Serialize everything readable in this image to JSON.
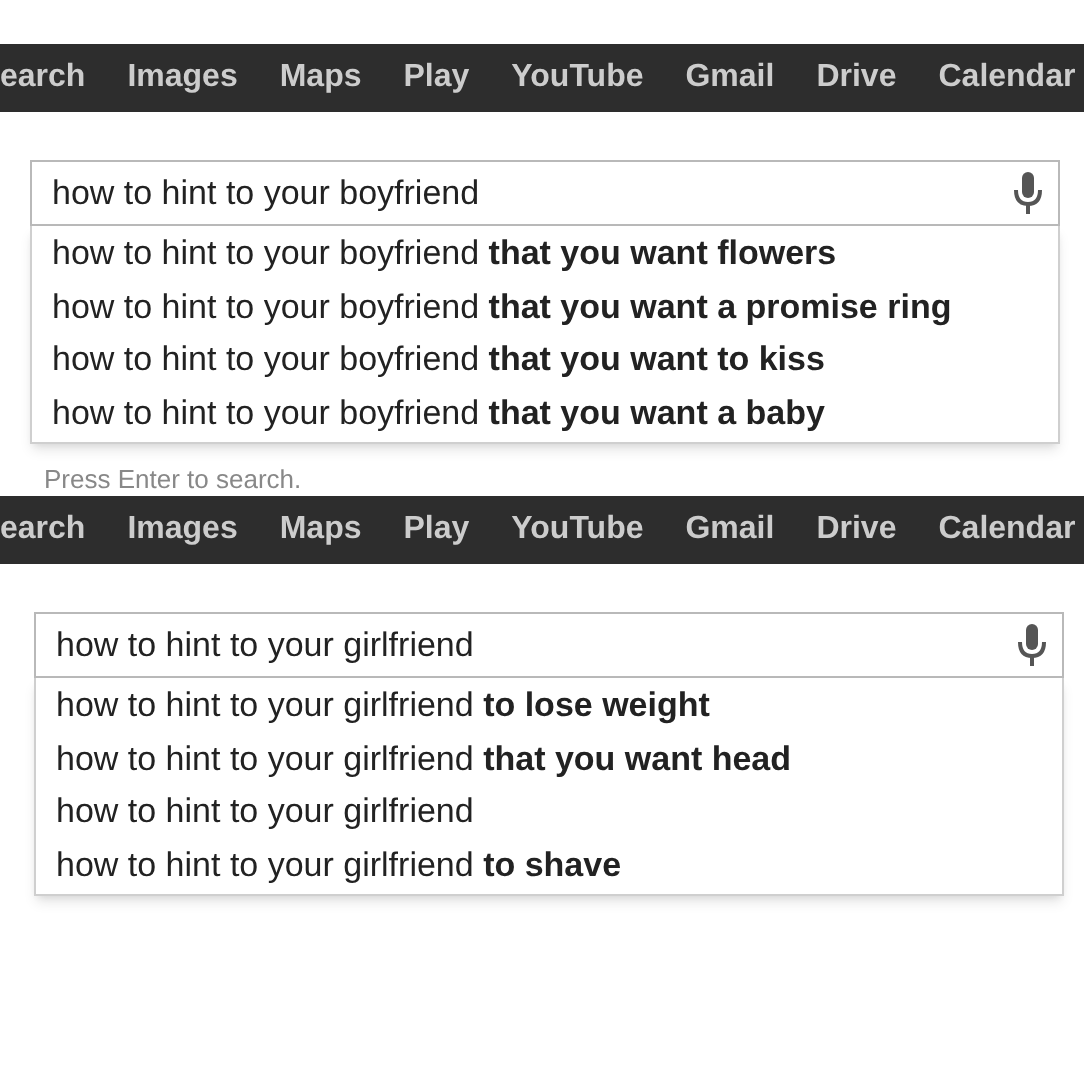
{
  "panels": [
    {
      "nav": [
        "earch",
        "Images",
        "Maps",
        "Play",
        "YouTube",
        "Gmail",
        "Drive",
        "Calendar"
      ],
      "query": "how to hint to your boyfriend",
      "suggestions": [
        "how to hint to your boyfriend **that you want flowers**",
        "how to hint to your boyfriend **that you want a promise ring**",
        "how to hint to your boyfriend **that you want to kiss**",
        "how to hint to your boyfriend **that you want a baby**"
      ],
      "hint": "Press Enter to search."
    },
    {
      "nav": [
        "earch",
        "Images",
        "Maps",
        "Play",
        "YouTube",
        "Gmail",
        "Drive",
        "Calendar"
      ],
      "query": "how to hint to your girlfriend",
      "suggestions": [
        "how to hint to your girlfriend **to lose weight**",
        "how to hint to your girlfriend **that you want head**",
        "how to hint to your girlfriend",
        "how to hint to your girlfriend **to shave**"
      ]
    }
  ]
}
